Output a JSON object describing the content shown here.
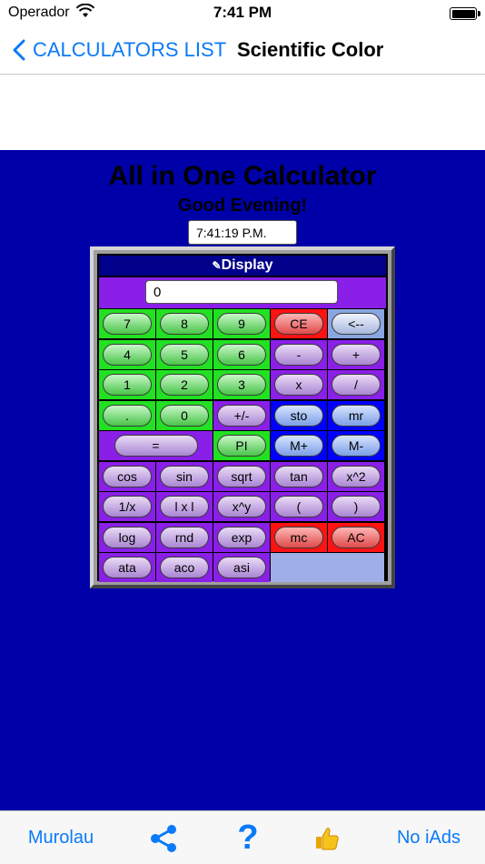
{
  "status": {
    "carrier": "Operador",
    "time": "7:41 PM"
  },
  "nav": {
    "back_label": "CALCULATORS LIST",
    "title": "Scientific Color"
  },
  "main": {
    "title": "All in One Calculator",
    "greeting": "Good Evening!",
    "clock": "7:41:19 P.M."
  },
  "calc": {
    "display_label": "Display",
    "display_value": "0",
    "colors": {
      "green": "#22e022",
      "purple": "#8a1fe8",
      "red": "#ff1212",
      "blue": "#0000ff",
      "background": "#0000a8"
    },
    "rows": [
      [
        {
          "label": "7",
          "cell": "green",
          "btn": "g"
        },
        {
          "label": "8",
          "cell": "green",
          "btn": "g"
        },
        {
          "label": "9",
          "cell": "green",
          "btn": "g"
        },
        {
          "label": "CE",
          "cell": "red",
          "btn": "r"
        },
        {
          "label": "<--",
          "cell": "light",
          "btn": "s"
        }
      ],
      [
        {
          "label": "4",
          "cell": "green",
          "btn": "g"
        },
        {
          "label": "5",
          "cell": "green",
          "btn": "g"
        },
        {
          "label": "6",
          "cell": "green",
          "btn": "g"
        },
        {
          "label": "-",
          "cell": "purple",
          "btn": "p"
        },
        {
          "label": "+",
          "cell": "purple",
          "btn": "p"
        }
      ],
      [
        {
          "label": "1",
          "cell": "green",
          "btn": "g"
        },
        {
          "label": "2",
          "cell": "green",
          "btn": "g"
        },
        {
          "label": "3",
          "cell": "green",
          "btn": "g"
        },
        {
          "label": "x",
          "cell": "purple",
          "btn": "p"
        },
        {
          "label": "/",
          "cell": "purple",
          "btn": "p"
        }
      ],
      [
        {
          "label": ".",
          "cell": "green",
          "btn": "g"
        },
        {
          "label": "0",
          "cell": "green",
          "btn": "g"
        },
        {
          "label": "+/-",
          "cell": "purple",
          "btn": "p"
        },
        {
          "label": "sto",
          "cell": "blue",
          "btn": "b"
        },
        {
          "label": "mr",
          "cell": "blue",
          "btn": "b"
        }
      ],
      [
        {
          "label": "=",
          "cell": "purple",
          "btn": "p",
          "span": 2
        },
        {
          "label": "PI",
          "cell": "green",
          "btn": "g"
        },
        {
          "label": "M+",
          "cell": "blue",
          "btn": "b"
        },
        {
          "label": "M-",
          "cell": "blue",
          "btn": "b"
        }
      ],
      [
        {
          "label": "cos",
          "cell": "purple",
          "btn": "p"
        },
        {
          "label": "sin",
          "cell": "purple",
          "btn": "p"
        },
        {
          "label": "sqrt",
          "cell": "purple",
          "btn": "p"
        },
        {
          "label": "tan",
          "cell": "purple",
          "btn": "p"
        },
        {
          "label": "x^2",
          "cell": "purple",
          "btn": "p"
        }
      ],
      [
        {
          "label": "1/x",
          "cell": "purple",
          "btn": "p"
        },
        {
          "label": "l x l",
          "cell": "purple",
          "btn": "p"
        },
        {
          "label": "x^y",
          "cell": "purple",
          "btn": "p"
        },
        {
          "label": "(",
          "cell": "purple",
          "btn": "p"
        },
        {
          "label": ")",
          "cell": "purple",
          "btn": "p"
        }
      ],
      [
        {
          "label": "log",
          "cell": "purple",
          "btn": "p"
        },
        {
          "label": "rnd",
          "cell": "purple",
          "btn": "p"
        },
        {
          "label": "exp",
          "cell": "purple",
          "btn": "p"
        },
        {
          "label": "mc",
          "cell": "red",
          "btn": "r"
        },
        {
          "label": "AC",
          "cell": "red",
          "btn": "r"
        }
      ],
      [
        {
          "label": "ata",
          "cell": "purple",
          "btn": "p"
        },
        {
          "label": "aco",
          "cell": "purple",
          "btn": "p"
        },
        {
          "label": "asi",
          "cell": "purple",
          "btn": "p"
        },
        {
          "label": "",
          "cell": "empty",
          "span": 2
        }
      ]
    ]
  },
  "tabbar": {
    "left_label": "Murolau",
    "share_icon": "share-icon",
    "help_icon": "question-mark-icon",
    "like_icon": "thumbs-up-icon",
    "right_label": "No iAds"
  }
}
